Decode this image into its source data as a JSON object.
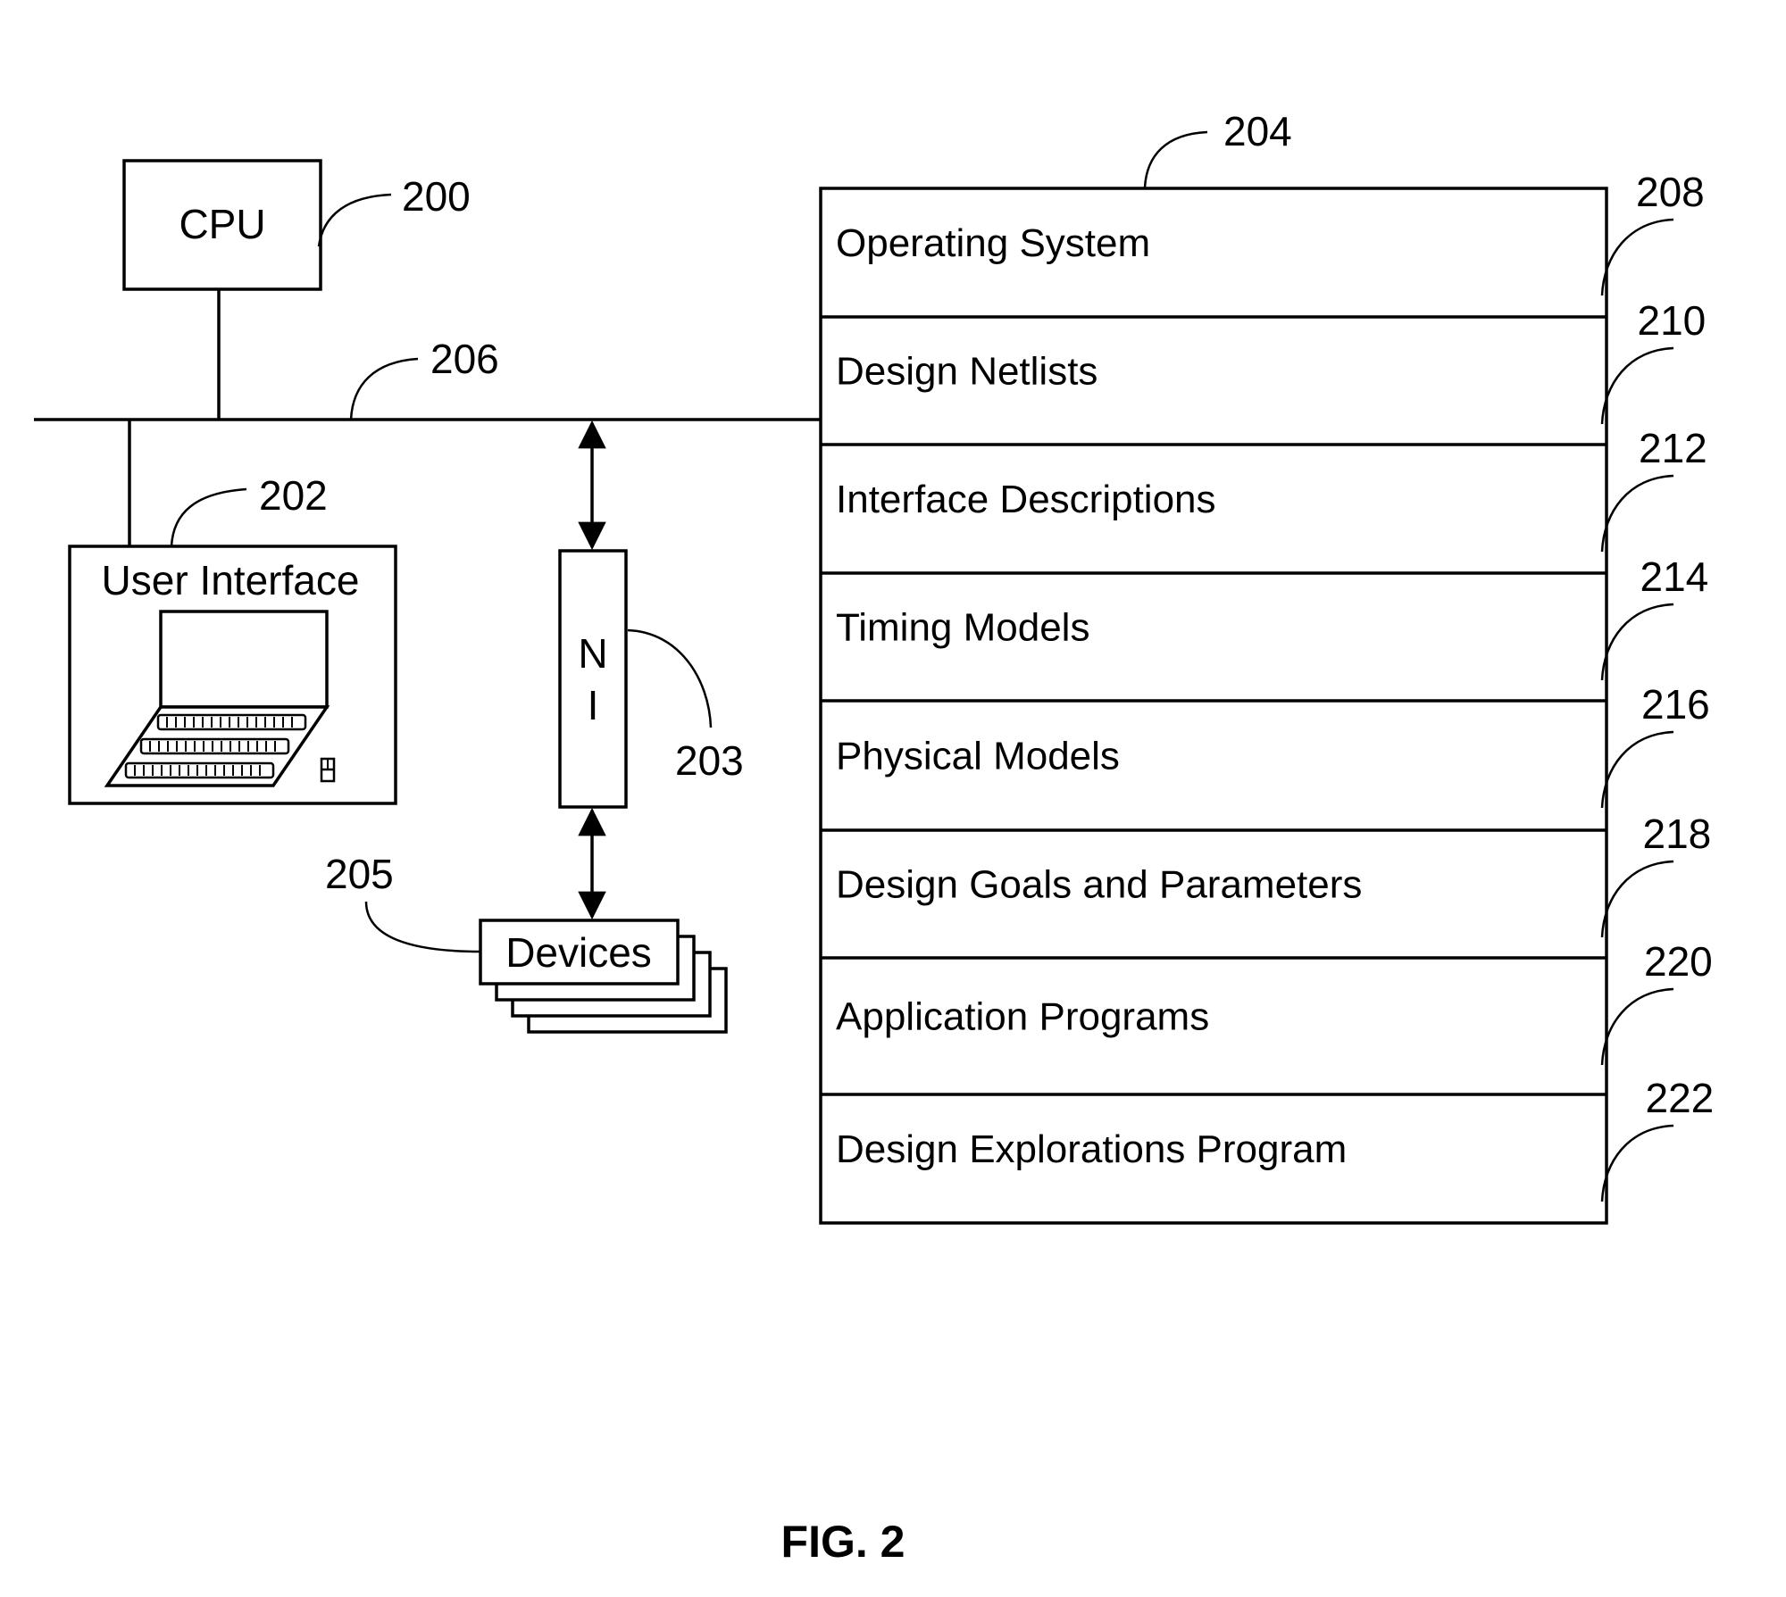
{
  "figure": {
    "caption": "FIG. 2"
  },
  "cpu": {
    "label": "CPU",
    "ref": "200"
  },
  "bus": {
    "ref": "206"
  },
  "user_interface": {
    "label": "User Interface",
    "ref": "202",
    "icon": "laptop-icon"
  },
  "network_interface": {
    "label_line1": "N",
    "label_line2": "I",
    "ref": "203"
  },
  "devices": {
    "label": "Devices",
    "ref": "205"
  },
  "memory": {
    "ref": "204",
    "sections": [
      {
        "label": "Operating System",
        "ref": "208"
      },
      {
        "label": "Design Netlists",
        "ref": "210"
      },
      {
        "label": "Interface Descriptions",
        "ref": "212"
      },
      {
        "label": "Timing Models",
        "ref": "214"
      },
      {
        "label": "Physical Models",
        "ref": "216"
      },
      {
        "label": "Design Goals and Parameters",
        "ref": "218"
      },
      {
        "label": "Application Programs",
        "ref": "220"
      },
      {
        "label": "Design Explorations Program",
        "ref": "222"
      }
    ]
  }
}
